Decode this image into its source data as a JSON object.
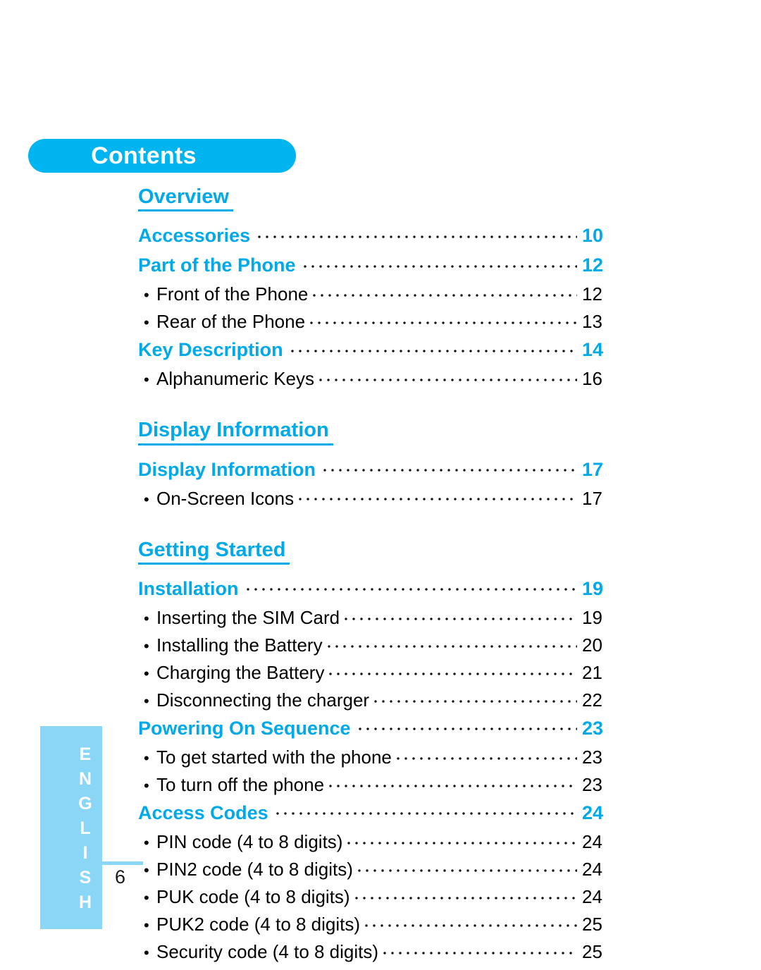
{
  "header": {
    "title": "Contents"
  },
  "colors": {
    "accent": "#00a9e8",
    "pill": "#00b4ef",
    "tab": "#8ad6f7",
    "text": "#000000"
  },
  "sidebar": {
    "language_label": "ENGLISH"
  },
  "footer": {
    "page_number": "6"
  },
  "sections": [
    {
      "heading": "Overview",
      "entries": [
        {
          "label": "Accessories",
          "page": "10",
          "level": "major"
        },
        {
          "label": "Part of the Phone",
          "page": "12",
          "level": "major"
        },
        {
          "label": "Front of the Phone",
          "page": "12",
          "level": "sub"
        },
        {
          "label": "Rear of the Phone",
          "page": "13",
          "level": "sub"
        },
        {
          "label": "Key Description",
          "page": "14",
          "level": "major"
        },
        {
          "label": "Alphanumeric Keys",
          "page": "16",
          "level": "sub"
        }
      ]
    },
    {
      "heading": "Display Information",
      "entries": [
        {
          "label": "Display Information",
          "page": "17",
          "level": "major"
        },
        {
          "label": "On-Screen Icons",
          "page": "17",
          "level": "sub"
        }
      ]
    },
    {
      "heading": "Getting Started",
      "entries": [
        {
          "label": "Installation",
          "page": "19",
          "level": "major"
        },
        {
          "label": "Inserting the SIM Card",
          "page": "19",
          "level": "sub"
        },
        {
          "label": "Installing the Battery",
          "page": "20",
          "level": "sub"
        },
        {
          "label": "Charging the Battery",
          "page": "21",
          "level": "sub"
        },
        {
          "label": "Disconnecting the charger",
          "page": "22",
          "level": "sub"
        },
        {
          "label": "Powering On Sequence",
          "page": "23",
          "level": "major"
        },
        {
          "label": "To get started with the phone",
          "page": "23",
          "level": "sub"
        },
        {
          "label": "To turn off the phone",
          "page": "23",
          "level": "sub"
        },
        {
          "label": "Access Codes",
          "page": "24",
          "level": "major"
        },
        {
          "label": "PIN code (4 to 8 digits)",
          "page": "24",
          "level": "sub"
        },
        {
          "label": "PIN2 code (4 to 8 digits)",
          "page": "24",
          "level": "sub"
        },
        {
          "label": "PUK code (4 to 8 digits)",
          "page": "24",
          "level": "sub"
        },
        {
          "label": "PUK2 code (4 to 8 digits)",
          "page": "25",
          "level": "sub"
        },
        {
          "label": "Security code (4 to 8 digits)",
          "page": "25",
          "level": "sub"
        }
      ]
    }
  ]
}
